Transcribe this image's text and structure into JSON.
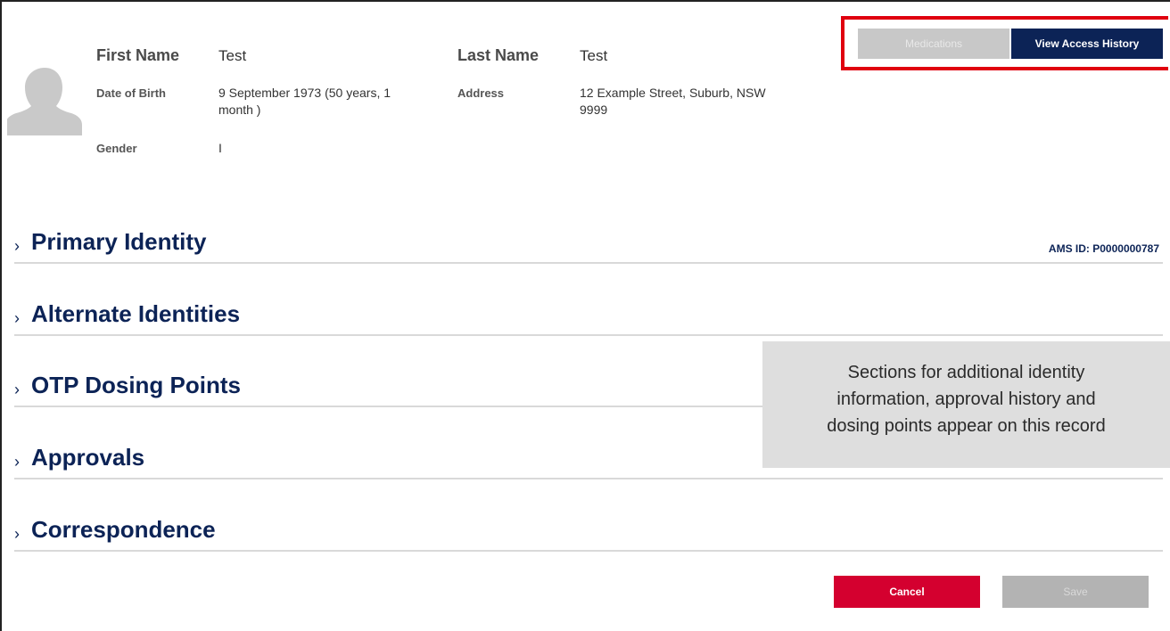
{
  "patient": {
    "first_name_label": "First Name",
    "first_name": "Test",
    "last_name_label": "Last Name",
    "last_name": "Test",
    "dob_label": "Date of Birth",
    "dob_line1": "9 September 1973  (50 years, 1",
    "dob_line2": "month )",
    "address_label": "Address",
    "address_line1": "12 Example Street, Suburb, NSW",
    "address_line2": "9999",
    "gender_label": "Gender",
    "gender": "I",
    "avatar_icon": "person-silhouette-icon"
  },
  "actions": {
    "medications_label": "Medications",
    "view_access_history_label": "View Access History",
    "cancel_label": "Cancel",
    "save_label": "Save"
  },
  "sections": [
    {
      "title": "Primary Identity",
      "chevron_icon": "chevron-right-icon"
    },
    {
      "title": "Alternate Identities",
      "chevron_icon": "chevron-right-icon"
    },
    {
      "title": "OTP Dosing Points",
      "chevron_icon": "chevron-right-icon"
    },
    {
      "title": "Approvals",
      "chevron_icon": "chevron-right-icon"
    },
    {
      "title": "Correspondence",
      "chevron_icon": "chevron-right-icon"
    }
  ],
  "ams_id": "AMS ID: P0000000787",
  "note": {
    "line1": "Sections for additional identity",
    "line2": "information, approval history and",
    "line3": "dosing points appear on this record"
  },
  "colors": {
    "navy": "#0c2356",
    "red": "#d4002f",
    "highlight": "#e0000f"
  }
}
